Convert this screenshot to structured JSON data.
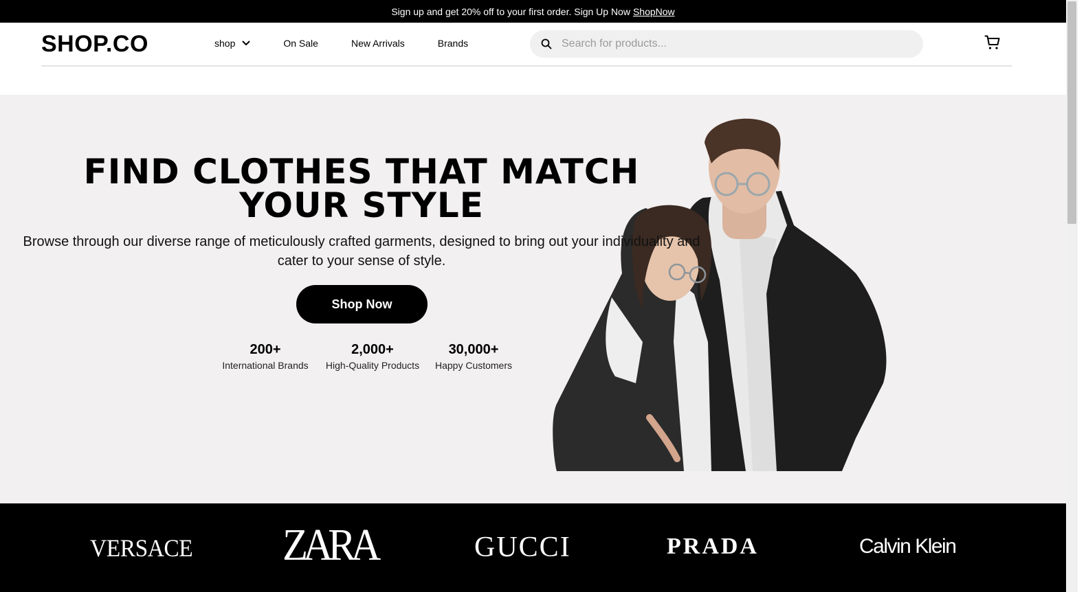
{
  "announcement": {
    "text": "Sign up and get 20% off to your first order. Sign Up Now",
    "link": "ShopNow"
  },
  "header": {
    "logo": "SHOP.CO",
    "nav": [
      {
        "label": "shop",
        "has_dropdown": true
      },
      {
        "label": "On Sale"
      },
      {
        "label": "New Arrivals"
      },
      {
        "label": "Brands"
      }
    ],
    "search": {
      "placeholder": "Search for products..."
    },
    "icons": [
      "search-icon",
      "cart-icon",
      "chevron-down-icon"
    ]
  },
  "hero": {
    "title": "FIND CLOTHES THAT MATCH YOUR STYLE",
    "description": "Browse through our diverse range of meticulously crafted garments, designed to bring out your individuality and cater to your sense of style.",
    "cta": "Shop Now",
    "stats": [
      {
        "value": "200+",
        "label": "International Brands"
      },
      {
        "value": "2,000+",
        "label": "High-Quality Products"
      },
      {
        "value": "30,000+",
        "label": "Happy Customers"
      }
    ]
  },
  "brands": [
    "VERSACE",
    "ZARA",
    "GUCCI",
    "PRADA",
    "Calvin Klein"
  ],
  "colors": {
    "announcement_bg": "#000000",
    "hero_bg": "#f2f0f1",
    "search_bg": "#f0f0f0",
    "brands_bg": "#000000",
    "button_bg": "#000000"
  }
}
